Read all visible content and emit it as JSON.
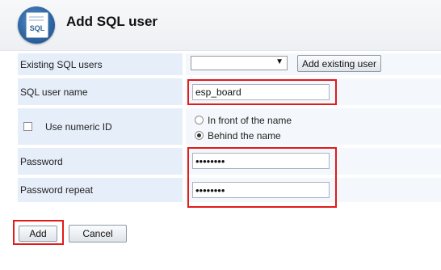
{
  "header": {
    "title": "Add SQL user",
    "logo_text": "SQL",
    "logo_icon": "sql-database-icon"
  },
  "form": {
    "existing_users": {
      "label": "Existing SQL users",
      "selected_value": "",
      "add_button_label": "Add existing user"
    },
    "user_name": {
      "label": "SQL user name",
      "value": "esp_board"
    },
    "numeric_id": {
      "label": "Use numeric ID",
      "checked": false,
      "options": [
        {
          "label": "In front of the name",
          "selected": false
        },
        {
          "label": "Behind the name",
          "selected": true
        }
      ]
    },
    "password": {
      "label": "Password",
      "masked_value": "••••••••"
    },
    "password_repeat": {
      "label": "Password repeat",
      "masked_value": "••••••••"
    }
  },
  "actions": {
    "add_label": "Add",
    "cancel_label": "Cancel"
  },
  "colors": {
    "label_background": "#e6eef9",
    "highlight": "#e21b1b"
  }
}
